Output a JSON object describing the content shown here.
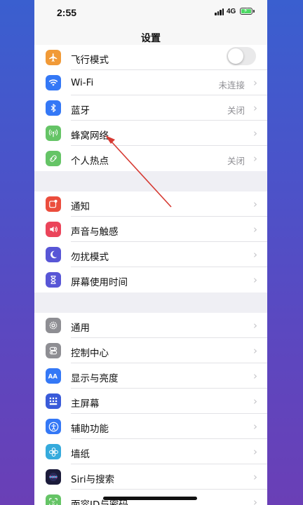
{
  "status": {
    "time": "2:55",
    "network": "4G",
    "battery_level": 1.0,
    "signal_bars": 4
  },
  "nav": {
    "title": "设置"
  },
  "groups": [
    {
      "items": [
        {
          "label": "飞行模式",
          "icon": "airplane-icon",
          "color": "#f19a37",
          "toggle": false
        },
        {
          "label": "Wi-Fi",
          "icon": "wifi-icon",
          "color": "#3478f6",
          "value": "未连接"
        },
        {
          "label": "蓝牙",
          "icon": "bluetooth-icon",
          "color": "#3478f6",
          "value": "关闭"
        },
        {
          "label": "蜂窝网络",
          "icon": "cellular-icon",
          "color": "#65c466",
          "value": ""
        },
        {
          "label": "个人热点",
          "icon": "hotspot-icon",
          "color": "#65c466",
          "value": "关闭"
        }
      ]
    },
    {
      "items": [
        {
          "label": "通知",
          "icon": "notifications-icon",
          "color": "#eb4d3d"
        },
        {
          "label": "声音与触感",
          "icon": "sound-icon",
          "color": "#eb445a"
        },
        {
          "label": "勿扰模式",
          "icon": "moon-icon",
          "color": "#5856d6"
        },
        {
          "label": "屏幕使用时间",
          "icon": "hourglass-icon",
          "color": "#5856d6"
        }
      ]
    },
    {
      "items": [
        {
          "label": "通用",
          "icon": "gear-icon",
          "color": "#8e8e93"
        },
        {
          "label": "控制中心",
          "icon": "switches-icon",
          "color": "#8e8e93"
        },
        {
          "label": "显示与亮度",
          "icon": "text-size-icon",
          "color": "#3478f6"
        },
        {
          "label": "主屏幕",
          "icon": "home-grid-icon",
          "color": "#3a5bd9"
        },
        {
          "label": "辅助功能",
          "icon": "accessibility-icon",
          "color": "#3478f6"
        },
        {
          "label": "墙纸",
          "icon": "flower-icon",
          "color": "#35aadc"
        },
        {
          "label": "Siri与搜索",
          "icon": "siri-icon",
          "color": "#1b1b3a"
        },
        {
          "label": "面容ID与密码",
          "icon": "faceid-icon",
          "color": "#65c466"
        }
      ]
    }
  ],
  "colors": {
    "annotation_arrow": "#d63a32",
    "chevron": "#c4c4c8",
    "secondary_text": "#8e8e93"
  }
}
